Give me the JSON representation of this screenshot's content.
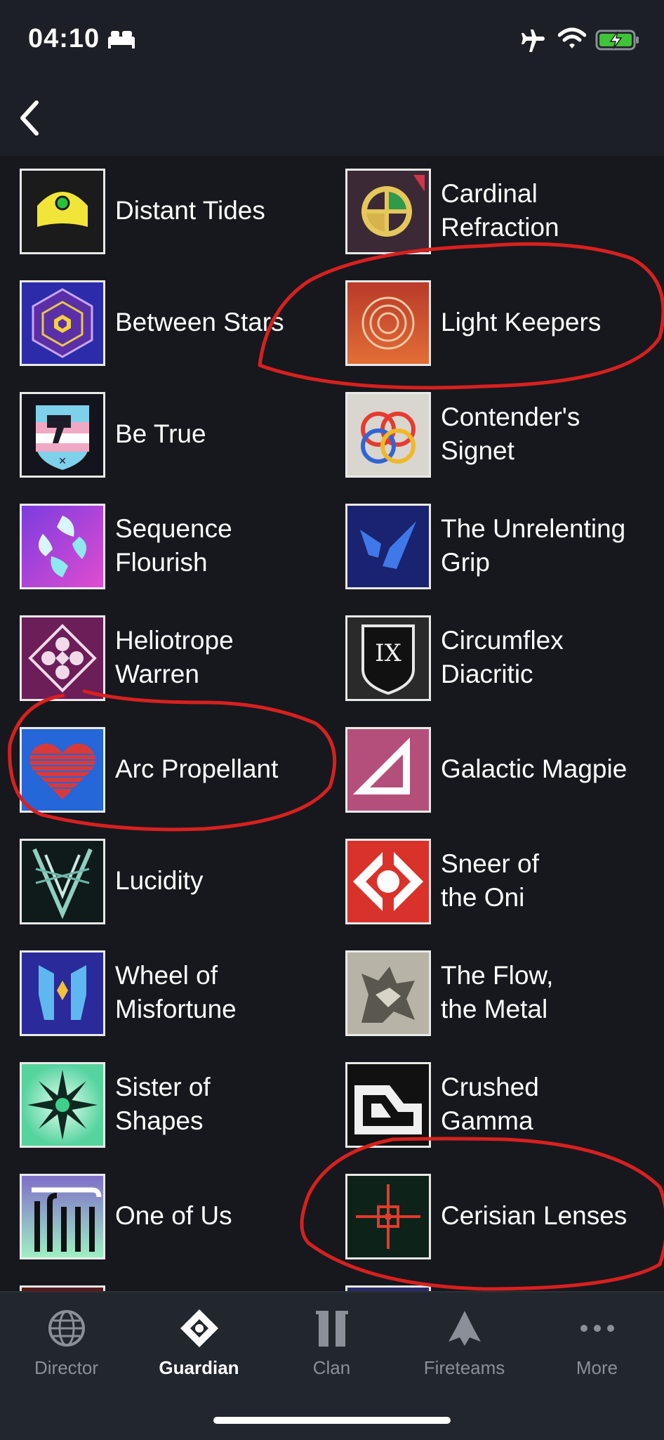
{
  "status_bar": {
    "time": "04:10",
    "icons": [
      "bed-icon",
      "airplane-icon",
      "wifi-icon",
      "battery-charging-icon"
    ],
    "battery_color": "#3ec436"
  },
  "nav": {
    "back_icon": "chevron-left-icon"
  },
  "emblems": [
    {
      "name": "Distant Tides",
      "icon": "distant-tides-emblem"
    },
    {
      "name": "Cardinal\nRefraction",
      "icon": "cardinal-refraction-emblem"
    },
    {
      "name": "Between Stars",
      "icon": "between-stars-emblem"
    },
    {
      "name": "Light Keepers",
      "icon": "light-keepers-emblem"
    },
    {
      "name": "Be True",
      "icon": "be-true-emblem"
    },
    {
      "name": "Contender's\nSignet",
      "icon": "contenders-signet-emblem"
    },
    {
      "name": "Sequence\nFlourish",
      "icon": "sequence-flourish-emblem"
    },
    {
      "name": "The Unrelenting\nGrip",
      "icon": "unrelenting-grip-emblem"
    },
    {
      "name": "Heliotrope\nWarren",
      "icon": "heliotrope-warren-emblem"
    },
    {
      "name": "Circumflex\nDiacritic",
      "icon": "circumflex-diacritic-emblem"
    },
    {
      "name": "Arc Propellant",
      "icon": "arc-propellant-emblem"
    },
    {
      "name": "Galactic Magpie",
      "icon": "galactic-magpie-emblem"
    },
    {
      "name": "Lucidity",
      "icon": "lucidity-emblem"
    },
    {
      "name": "Sneer of\nthe Oni",
      "icon": "sneer-of-the-oni-emblem"
    },
    {
      "name": "Wheel of\nMisfortune",
      "icon": "wheel-of-misfortune-emblem"
    },
    {
      "name": "The Flow,\nthe Metal",
      "icon": "flow-the-metal-emblem"
    },
    {
      "name": "Sister of\nShapes",
      "icon": "sister-of-shapes-emblem"
    },
    {
      "name": "Crushed\nGamma",
      "icon": "crushed-gamma-emblem"
    },
    {
      "name": "One of Us",
      "icon": "one-of-us-emblem"
    },
    {
      "name": "Cerisian Lenses",
      "icon": "cerisian-lenses-emblem"
    },
    {
      "name": "",
      "icon": "partial-emblem"
    },
    {
      "name": "",
      "icon": "partial-emblem"
    }
  ],
  "emblem_thumb_text": {
    "circumflex_diacritic": "IX"
  },
  "annotations": {
    "color": "#d8201f",
    "circled": [
      "Light Keepers",
      "Arc Propellant",
      "Cerisian Lenses"
    ]
  },
  "tab_bar": {
    "tabs": [
      {
        "label": "Director",
        "icon": "globe-icon",
        "active": false
      },
      {
        "label": "Guardian",
        "icon": "diamond-ghost-icon",
        "active": true
      },
      {
        "label": "Clan",
        "icon": "clan-banner-icon",
        "active": false
      },
      {
        "label": "Fireteams",
        "icon": "ship-icon",
        "active": false
      },
      {
        "label": "More",
        "icon": "more-dots-icon",
        "active": false
      }
    ]
  }
}
